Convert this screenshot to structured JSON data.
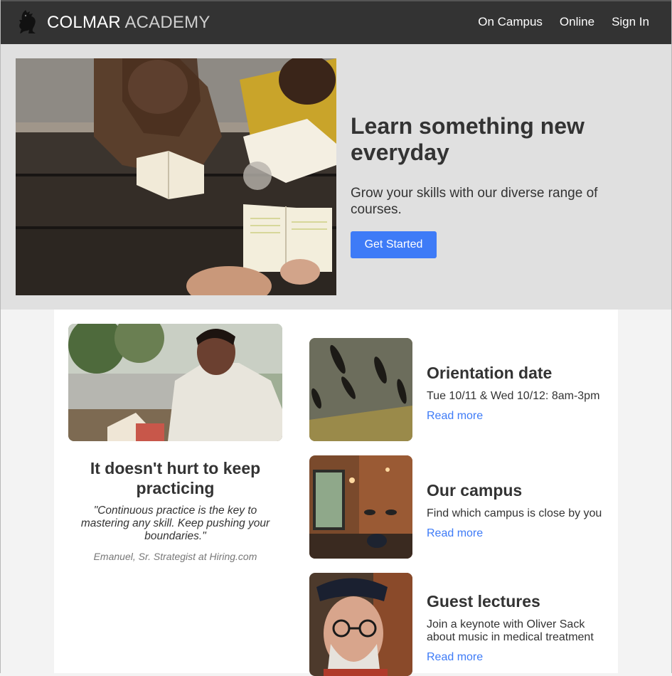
{
  "nav": {
    "brand_primary": "COLMAR",
    "brand_secondary": "ACADEMY",
    "links": [
      "On Campus",
      "Online",
      "Sign In"
    ],
    "logo_icon": "griffin-icon"
  },
  "hero": {
    "title": "Learn something new everyday",
    "subtitle": "Grow your skills with our diverse range of courses.",
    "cta_label": "Get Started"
  },
  "testimonial": {
    "title": "It doesn't hurt to keep practicing",
    "quote": "\"Continuous practice is the key to mastering any skill. Keep pushing your boundaries.\"",
    "author": "Emanuel, Sr. Strategist at Hiring.com"
  },
  "events": [
    {
      "title": "Orientation date",
      "description": "Tue 10/11 & Wed 10/12: 8am-3pm",
      "link": "Read more"
    },
    {
      "title": "Our campus",
      "description": "Find which campus is close by you",
      "link": "Read more"
    },
    {
      "title": "Guest lectures",
      "description": "Join a keynote with Oliver Sack about music in medical treatment",
      "link": "Read more"
    }
  ],
  "colors": {
    "nav_bg": "#333333",
    "hero_bg": "#e0e0e0",
    "accent": "#3e7bf7",
    "page_bg": "#f3f3f3"
  }
}
